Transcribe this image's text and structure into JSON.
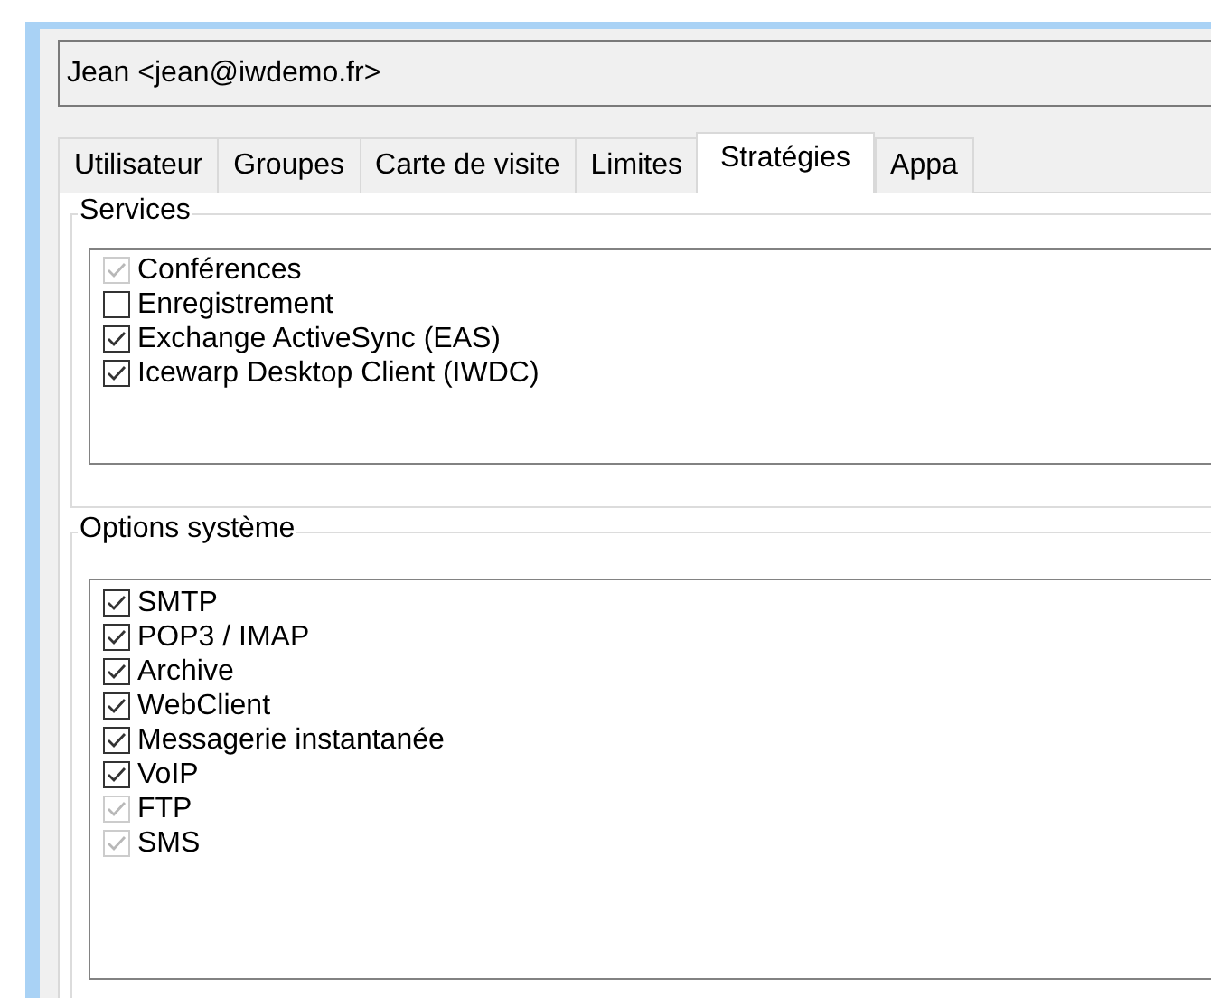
{
  "user_field": {
    "value": "Jean <jean@iwdemo.fr>"
  },
  "tabs": [
    {
      "label": "Utilisateur",
      "selected": false
    },
    {
      "label": "Groupes",
      "selected": false
    },
    {
      "label": "Carte de visite",
      "selected": false
    },
    {
      "label": "Limites",
      "selected": false
    },
    {
      "label": "Stratégies",
      "selected": true
    },
    {
      "label": "Appa",
      "selected": false
    }
  ],
  "groups": [
    {
      "title": "Services",
      "items": [
        {
          "label": "Conférences",
          "checked": true,
          "disabled": true
        },
        {
          "label": "Enregistrement",
          "checked": false,
          "disabled": false
        },
        {
          "label": "Exchange ActiveSync (EAS)",
          "checked": true,
          "disabled": false
        },
        {
          "label": "Icewarp Desktop Client (IWDC)",
          "checked": true,
          "disabled": false
        }
      ]
    },
    {
      "title": "Options système",
      "items": [
        {
          "label": "SMTP",
          "checked": true,
          "disabled": false
        },
        {
          "label": "POP3 / IMAP",
          "checked": true,
          "disabled": false
        },
        {
          "label": "Archive",
          "checked": true,
          "disabled": false
        },
        {
          "label": "WebClient",
          "checked": true,
          "disabled": false
        },
        {
          "label": "Messagerie instantanée",
          "checked": true,
          "disabled": false
        },
        {
          "label": "VoIP",
          "checked": true,
          "disabled": false
        },
        {
          "label": "FTP",
          "checked": true,
          "disabled": true
        },
        {
          "label": "SMS",
          "checked": true,
          "disabled": true
        }
      ]
    }
  ]
}
